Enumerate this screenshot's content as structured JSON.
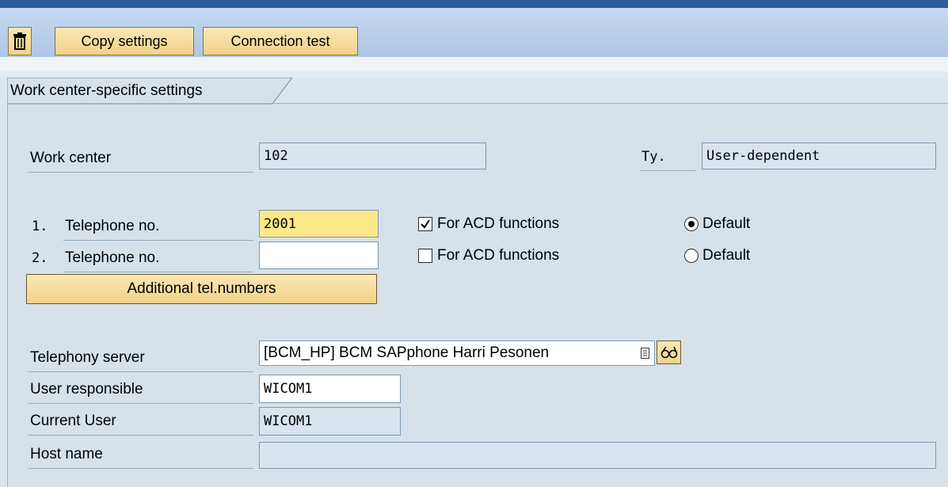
{
  "toolbar": {
    "delete_icon": "trash-icon",
    "copy_settings": "Copy settings",
    "connection_test": "Connection test"
  },
  "tab": {
    "title": "Work center-specific settings"
  },
  "work_center": {
    "label": "Work center",
    "value": "102"
  },
  "type": {
    "label": "Ty.",
    "value": "User-dependent"
  },
  "phone1": {
    "num": "1.",
    "label": "Telephone no.",
    "value": "2001",
    "acd_label": "For ACD functions",
    "acd_checked": true,
    "default_label": "Default",
    "default_selected": true
  },
  "phone2": {
    "num": "2.",
    "label": "Telephone no.",
    "value": "",
    "acd_label": "For ACD functions",
    "acd_checked": false,
    "default_label": "Default",
    "default_selected": false
  },
  "additional_button": "Additional tel.numbers",
  "telephony_server": {
    "label": "Telephony server",
    "value": "[BCM_HP] BCM SAPphone Harri Pesonen"
  },
  "user_responsible": {
    "label": "User responsible",
    "value": "WICOM1"
  },
  "current_user": {
    "label": "Current User",
    "value": "WICOM1"
  },
  "host_name": {
    "label": "Host name",
    "value": ""
  },
  "colors": {
    "toolbar": "#aec6e6",
    "button": "#f1d28a",
    "highlight_field": "#fde98a",
    "panel": "#d6e1ea"
  }
}
